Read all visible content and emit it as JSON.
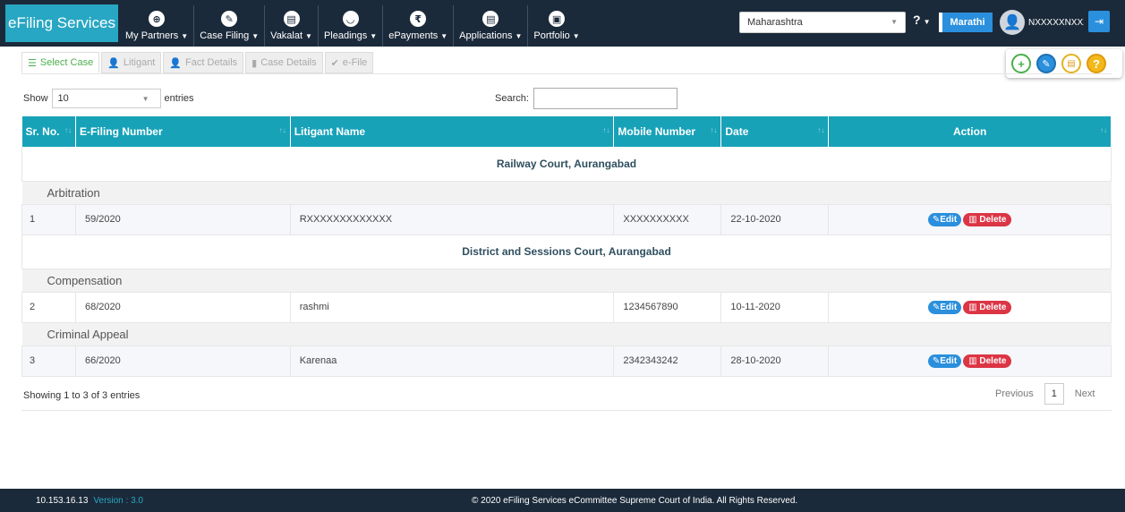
{
  "brand": "eFiling Services",
  "nav": [
    {
      "icon": "partners-icon",
      "glyph": "⊕",
      "label": "My Partners"
    },
    {
      "icon": "pencil-icon",
      "glyph": "✎",
      "label": "Case Filing"
    },
    {
      "icon": "document-icon",
      "glyph": "▤",
      "label": "Vakalat"
    },
    {
      "icon": "pleadings-icon",
      "glyph": "◡",
      "label": "Pleadings"
    },
    {
      "icon": "rupee-icon",
      "glyph": "₹",
      "label": "ePayments"
    },
    {
      "icon": "document-icon",
      "glyph": "▤",
      "label": "Applications"
    },
    {
      "icon": "briefcase-icon",
      "glyph": "▣",
      "label": "Portfolio"
    }
  ],
  "state_select": "Maharashtra",
  "help_label": "?",
  "lang_button": "Marathi",
  "user_name": "NXXXXXNXXXh...",
  "tabs": [
    {
      "label": "Select Case",
      "glyph": "☰"
    },
    {
      "label": "Litigant",
      "glyph": "👤"
    },
    {
      "label": "Fact Details",
      "glyph": "👤"
    },
    {
      "label": "Case Details",
      "glyph": "▮"
    },
    {
      "label": "e-File",
      "glyph": "✔"
    }
  ],
  "controls": {
    "show_label": "Show",
    "entries_value": "10",
    "entries_label": "entries",
    "search_label": "Search:",
    "search_value": ""
  },
  "table": {
    "headers": [
      "Sr. No.",
      "E-Filing Number",
      "Litigant Name",
      "Mobile Number",
      "Date",
      "Action"
    ],
    "groups": [
      {
        "court": "Railway Court, Aurangabad",
        "categories": [
          {
            "name": "Arbitration",
            "rows": [
              {
                "sr": "1",
                "efiling": "59/2020",
                "litigant": "RXXXXXXXXXXXXX",
                "mobile": "XXXXXXXXXX",
                "date": "22-10-2020"
              }
            ]
          }
        ]
      },
      {
        "court": "District and Sessions Court, Aurangabad",
        "categories": [
          {
            "name": "Compensation",
            "rows": [
              {
                "sr": "2",
                "efiling": "68/2020",
                "litigant": "rashmi",
                "mobile": "1234567890",
                "date": "10-11-2020"
              }
            ]
          },
          {
            "name": "Criminal Appeal",
            "rows": [
              {
                "sr": "3",
                "efiling": "66/2020",
                "litigant": "Karenaa",
                "mobile": "2342343242",
                "date": "28-10-2020"
              }
            ]
          }
        ]
      }
    ],
    "edit_label": "Edit",
    "delete_label": "Delete"
  },
  "showing": "Showing 1 to 3 of 3 entries",
  "pagination": {
    "previous": "Previous",
    "page": "1",
    "next": "Next"
  },
  "footer": {
    "ip": "10.153.16.13",
    "version": "Version : 3.0",
    "copyright": "© 2020 eFiling Services eCommittee Supreme Court of India. All Rights Reserved."
  }
}
